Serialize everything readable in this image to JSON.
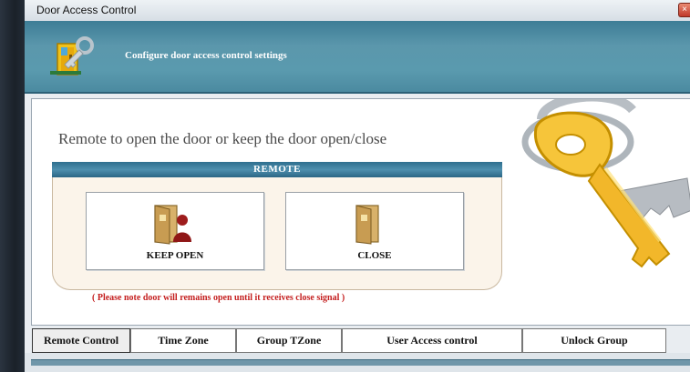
{
  "window": {
    "title": "Door Access Control",
    "close_glyph": "×"
  },
  "header": {
    "subtitle": "Configure door access control settings",
    "icon": "door-key-icon"
  },
  "main": {
    "headline": "Remote to open the door or  keep the door open/close",
    "remote": {
      "title": "REMOTE",
      "buttons": [
        {
          "label": "KEEP OPEN",
          "icon": "door-person-icon"
        },
        {
          "label": "CLOSE",
          "icon": "door-icon"
        }
      ]
    },
    "note": "( Please note door will remains open until it receives close signal )",
    "decoration": "keys-icon"
  },
  "tabs": [
    {
      "label": "Remote Control",
      "active": true
    },
    {
      "label": "Time Zone",
      "active": false
    },
    {
      "label": "Group TZone",
      "active": false
    },
    {
      "label": "User Access control",
      "active": false
    },
    {
      "label": "Unlock Group",
      "active": false
    }
  ],
  "colors": {
    "header_teal": "#5a9aae",
    "remote_bar": "#3b7a98",
    "note_red": "#c41e1e",
    "panel_cream": "#fbf4ea"
  }
}
